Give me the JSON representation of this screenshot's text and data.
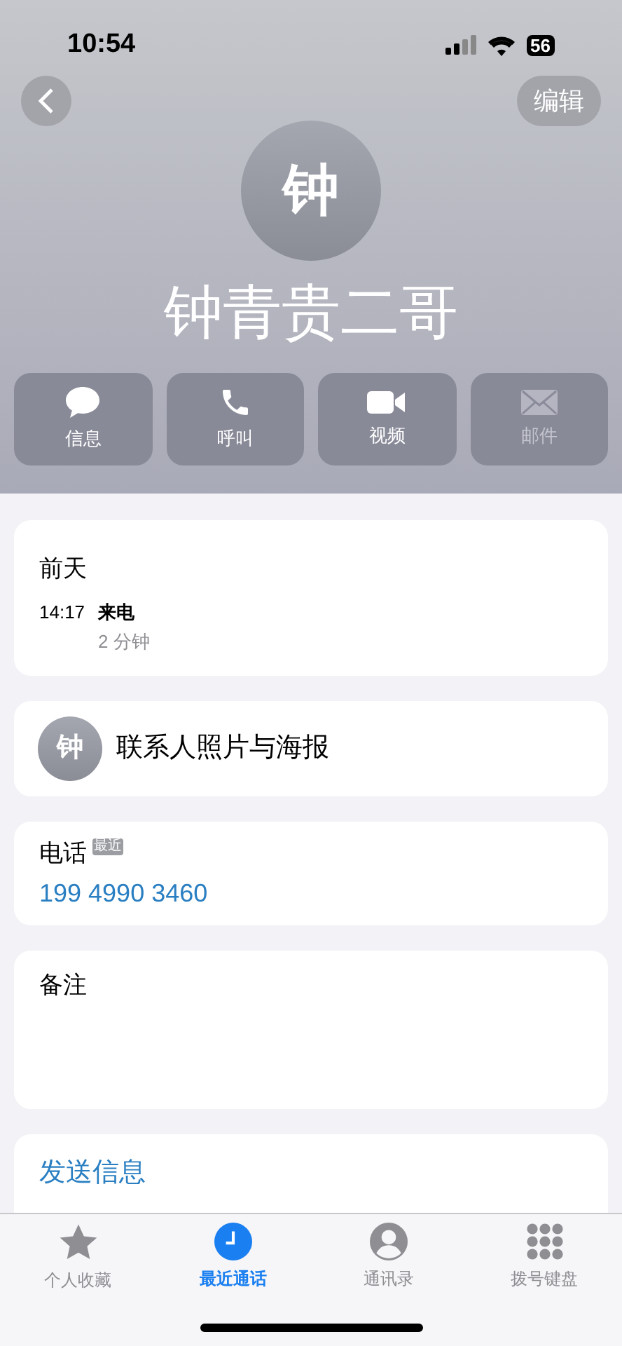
{
  "status_bar": {
    "time": "10:54",
    "battery": "56"
  },
  "nav": {
    "edit": "编辑"
  },
  "contact": {
    "initial": "钟",
    "name": "钟青贵二哥"
  },
  "actions": [
    {
      "kind": "message",
      "label": "信息",
      "disabled": false
    },
    {
      "kind": "call",
      "label": "呼叫",
      "disabled": false
    },
    {
      "kind": "video",
      "label": "视频",
      "disabled": false
    },
    {
      "kind": "mail",
      "label": "邮件",
      "disabled": true
    }
  ],
  "call_log": {
    "day": "前天",
    "entries": [
      {
        "time": "14:17",
        "type": "来电",
        "duration": "2 分钟"
      }
    ]
  },
  "poster": {
    "initial": "钟",
    "label": "联系人照片与海报"
  },
  "phone": {
    "label": "电话",
    "badge": "最近",
    "number": "199 4990 3460"
  },
  "notes": {
    "label": "备注"
  },
  "send_message": "发送信息",
  "tabs": [
    {
      "kind": "favorites",
      "label": "个人收藏",
      "selected": false
    },
    {
      "kind": "recents",
      "label": "最近通话",
      "selected": true
    },
    {
      "kind": "contacts",
      "label": "通讯录",
      "selected": false
    },
    {
      "kind": "keypad",
      "label": "拨号键盘",
      "selected": false
    }
  ]
}
